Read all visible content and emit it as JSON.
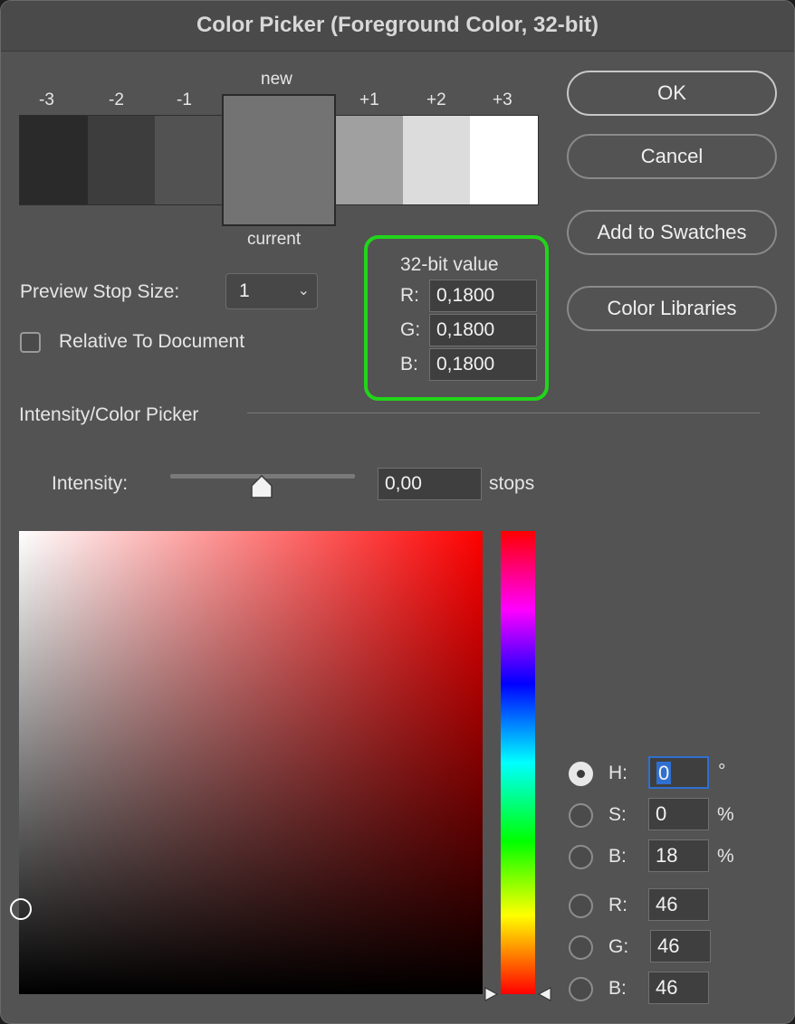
{
  "title": "Color Picker (Foreground Color, 32-bit)",
  "stops": {
    "labels_left": [
      "-3",
      "-2",
      "-1"
    ],
    "labels_right": [
      "+1",
      "+2",
      "+3"
    ],
    "colors_left": [
      "#2a2a2a",
      "#3d3d3d",
      "#525252"
    ],
    "colors_right": [
      "#a0a0a0",
      "#dcdcdc",
      "#ffffff"
    ],
    "new_label": "new",
    "current_label": "current",
    "new_color": "#737373"
  },
  "buttons": {
    "ok": "OK",
    "cancel": "Cancel",
    "add_to_swatches": "Add to Swatches",
    "color_libraries": "Color Libraries"
  },
  "preview": {
    "label": "Preview Stop Size:",
    "value": "1",
    "chevron": "chevron-down-icon"
  },
  "relative": {
    "label": "Relative To Document",
    "checked": false
  },
  "value32": {
    "heading": "32-bit value",
    "r_label": "R:",
    "r": "0,1800",
    "g_label": "G:",
    "g": "0,1800",
    "b_label": "B:",
    "b": "0,1800",
    "highlight_color": "#22d51a"
  },
  "section": "Intensity/Color Picker",
  "intensity": {
    "label": "Intensity:",
    "value": "0,00",
    "unit": "stops"
  },
  "hsb": {
    "h_label": "H:",
    "h": "0",
    "h_unit": "°",
    "s_label": "S:",
    "s": "0",
    "s_unit": "%",
    "b_label": "B:",
    "b": "18",
    "b_unit": "%"
  },
  "rgb": {
    "r_label": "R:",
    "r": "46",
    "g_label": "G:",
    "g": "46",
    "b_label": "B:",
    "b": "46"
  },
  "selected_mode": "H"
}
